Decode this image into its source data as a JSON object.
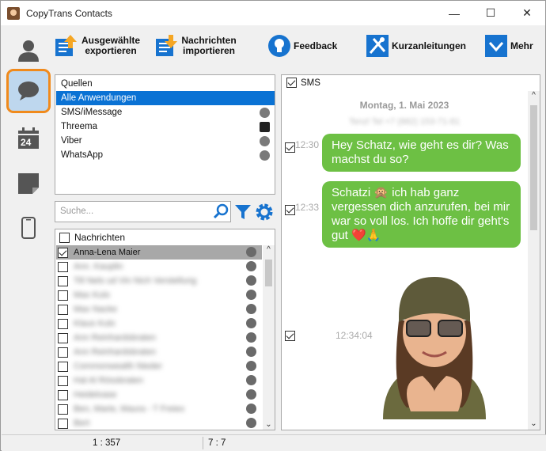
{
  "window": {
    "title": "CopyTrans Contacts"
  },
  "sidebar": {
    "items": [
      {
        "name": "contacts",
        "icon": "person-icon"
      },
      {
        "name": "messages",
        "icon": "chat-bubble-icon"
      },
      {
        "name": "calendar",
        "icon": "calendar-icon",
        "label": "24"
      },
      {
        "name": "notes",
        "icon": "note-icon"
      },
      {
        "name": "device",
        "icon": "phone-icon"
      }
    ]
  },
  "toolbar": {
    "export": "Ausgewählte exportieren",
    "import": "Nachrichten importieren",
    "feedback": "Feedback",
    "guides": "Kurzanleitungen",
    "more": "Mehr"
  },
  "sources": {
    "header": "Quellen",
    "items": [
      "Alle Anwendungen",
      "SMS/iMessage",
      "Threema",
      "Viber",
      "WhatsApp"
    ]
  },
  "search": {
    "placeholder": "Suche..."
  },
  "contacts": {
    "header": "Nachrichten",
    "items": [
      "Anna-Lena Maier",
      "Ann. Kauplin",
      "Till Nels ud Vin Nich Verstellung",
      "Max Kulo",
      "Max Nacke",
      "Klaus Kulo",
      "Ann Reinhardsbraten",
      "Ann Reinhardsbraten",
      "Commonwealth Nieder",
      "Hal Al Rössbraten",
      "Heidelvase",
      "Ben, Marie, Maura - T Freiex",
      "Bert"
    ]
  },
  "conversation": {
    "header": "SMS",
    "date": "Montag, 1. Mai 2023",
    "number": "Tenzl Tel +7 (882) 153-71-81",
    "messages": [
      {
        "time": "12:30",
        "text": "Hey Schatz, wie geht es dir? Was machst du so?"
      },
      {
        "time": "12:33",
        "text": "Schatzi 🙊 ich hab ganz vergessen dich anzurufen, bei mir war so voll los. Ich hoffe dir geht's gut ❤️🙏"
      },
      {
        "time": "12:34:04",
        "text": ""
      }
    ]
  },
  "status": {
    "left": "1 : 357",
    "right": "7 : 7"
  },
  "colors": {
    "accent": "#0a72d4",
    "bubble": "#6dc044",
    "active_border": "#f08a1c",
    "active_bg": "#bed7ee"
  }
}
